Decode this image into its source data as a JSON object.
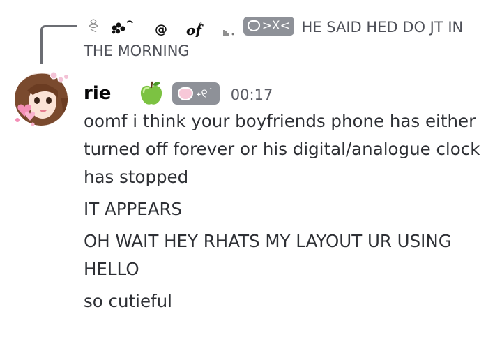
{
  "reply": {
    "author_tag": ">ⵝ<",
    "text": "HE SAID HED DO JT IN THE MORNING"
  },
  "message": {
    "username": "rie",
    "guild_tag": "˖୧˙",
    "timestamp": "00:17",
    "lines": [
      "oomf i think your boyfriends phone has either turned off forever or his digital/analogue clock has stopped",
      "IT APPEARS",
      "OH WAIT HEY RHATS MY LAYOUT UR USING HELLO",
      "so cutieful"
    ]
  },
  "icons": {
    "reply": "reply-spine-icon",
    "avatar": "anime-girl-avatar",
    "badge": "green-apple-icon",
    "tag": "heart-icon"
  },
  "colors": {
    "tag_background": "#8e9198",
    "username": "#060607",
    "text": "#2e3035",
    "timestamp": "#5c5e66"
  }
}
